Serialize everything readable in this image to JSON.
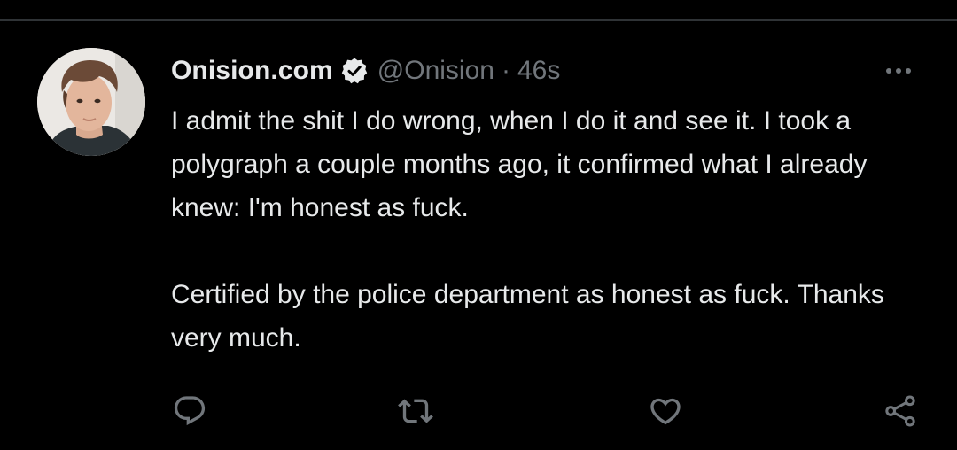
{
  "tweet": {
    "display_name": "Onision.com",
    "handle": "@Onision",
    "separator": "·",
    "timestamp": "46s",
    "verified": true,
    "text_paragraphs": [
      "I admit the shit I do wrong, when I do it and see it. I took a polygraph a couple months ago, it confirmed what I already knew: I'm honest as fuck.",
      "Certified by the police department as honest as fuck. Thanks very much."
    ]
  },
  "actions": {
    "icons": [
      "reply-icon",
      "retweet-icon",
      "like-icon",
      "share-icon"
    ]
  },
  "colors": {
    "background": "#000000",
    "primary_text": "#e7e9ea",
    "secondary_text": "#71767b",
    "divider": "#2f3336"
  }
}
